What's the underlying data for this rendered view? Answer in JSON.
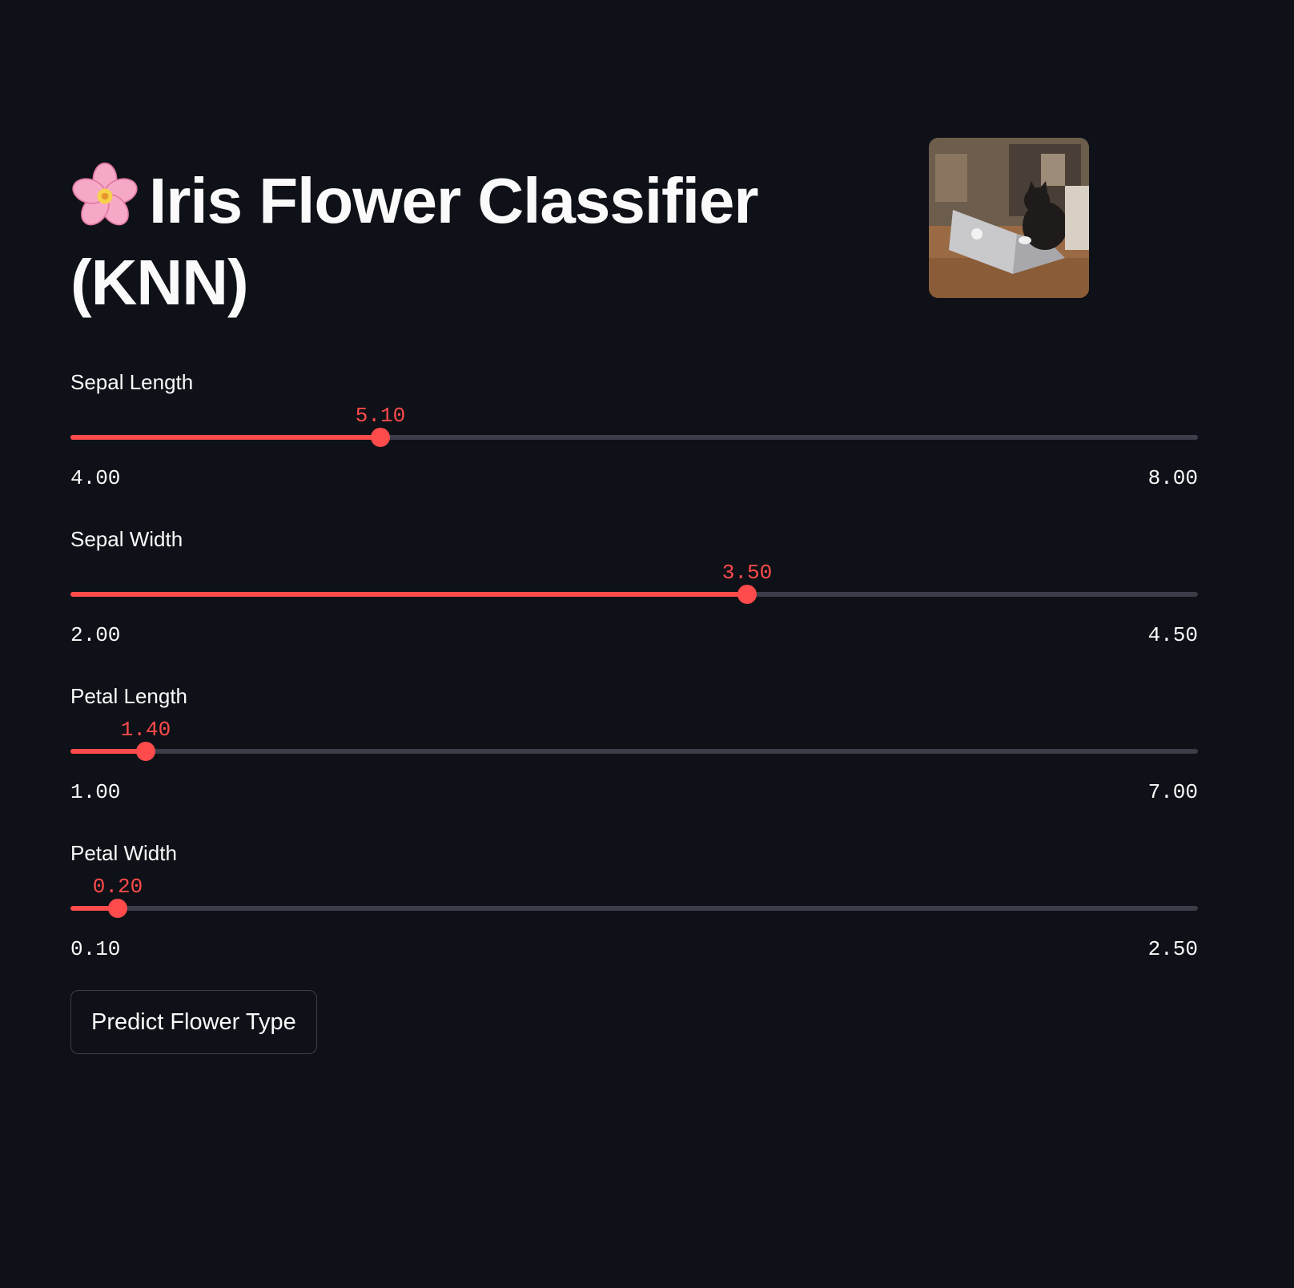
{
  "header": {
    "title": "Iris Flower Classifier (KNN)",
    "title_icon": "cherry-blossom-icon"
  },
  "thumbnail": {
    "description_icon": "cat-typing-on-laptop-image"
  },
  "sliders": [
    {
      "label": "Sepal Length",
      "value": "5.10",
      "min": "4.00",
      "max": "8.00",
      "fraction": 0.275
    },
    {
      "label": "Sepal Width",
      "value": "3.50",
      "min": "2.00",
      "max": "4.50",
      "fraction": 0.6
    },
    {
      "label": "Petal Length",
      "value": "1.40",
      "min": "1.00",
      "max": "7.00",
      "fraction": 0.0667
    },
    {
      "label": "Petal Width",
      "value": "0.20",
      "min": "0.10",
      "max": "2.50",
      "fraction": 0.0417
    }
  ],
  "actions": {
    "predict_label": "Predict Flower Type"
  },
  "colors": {
    "background": "#0e1117",
    "accent": "#ff4b4b",
    "track": "#3b3d48",
    "text": "#fafafa"
  }
}
